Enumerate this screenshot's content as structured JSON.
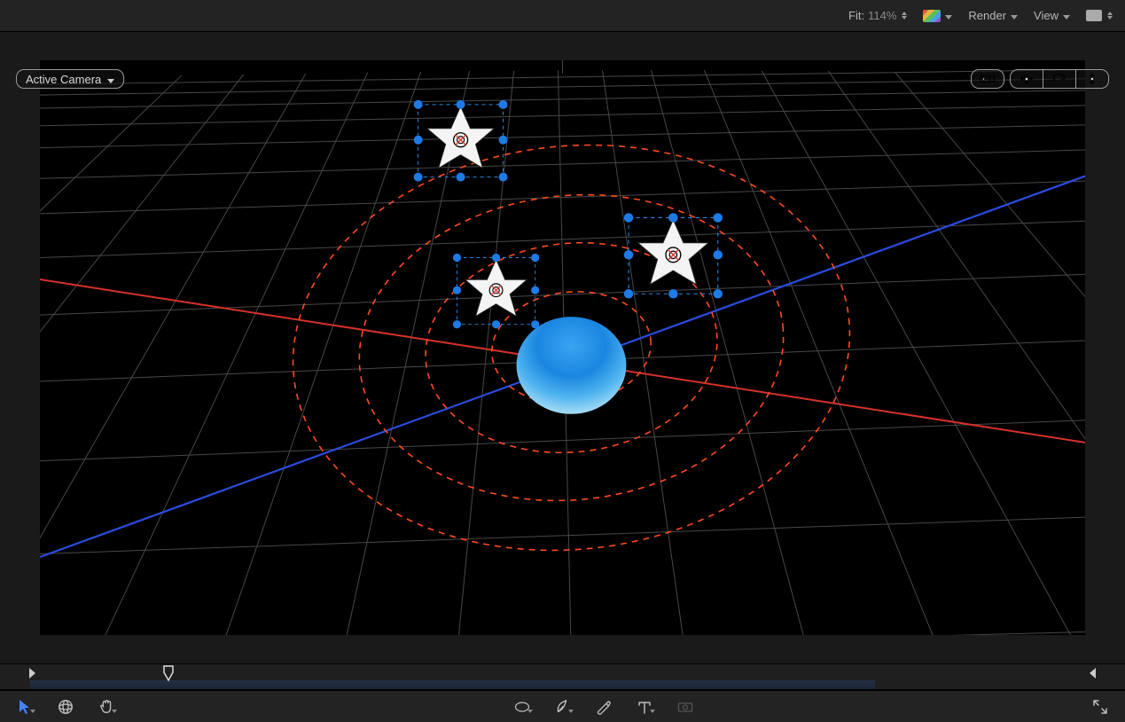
{
  "topbar": {
    "fit_label": "Fit:",
    "fit_value": "114%",
    "render_label": "Render",
    "view_label": "View"
  },
  "overlay": {
    "camera_select": "Active Camera"
  },
  "colors": {
    "grid": "#6a6a6a",
    "axis_x": "#d13a2f",
    "axis_z": "#1f47d6",
    "orbit": "#ff4a1f",
    "sphere_top": "#1a8de8",
    "sphere_bottom": "#9fd5f5",
    "star_fill": "#f5f5f5",
    "handle": "#1e7be6"
  },
  "scene": {
    "orbit_count": 4,
    "stars": 3,
    "center_object": "sphere"
  }
}
